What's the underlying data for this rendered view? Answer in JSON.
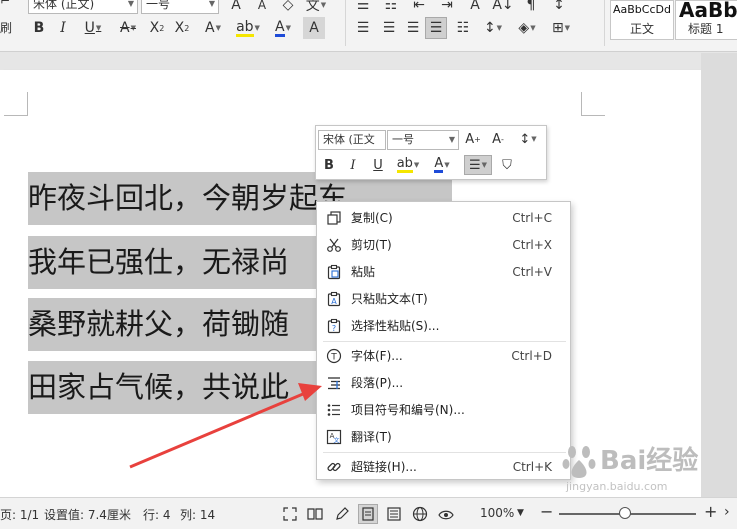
{
  "ribbon": {
    "left_edge_char": "刷",
    "font_name": "宋体 (正文)",
    "font_size": "一号",
    "styles": [
      {
        "sample": "AaBbCcDd",
        "name": "正文"
      },
      {
        "sample": "AaBb",
        "name": "标题 1"
      }
    ],
    "accent_font_color": "#1e4bd8",
    "highlight_color": "#f5e600"
  },
  "mini_toolbar": {
    "font_name": "宋体 (正文",
    "font_size": "一号"
  },
  "document": {
    "lines": [
      {
        "visible": "昨夜斗回北，今朝岁起东"
      },
      {
        "visible": "我年已强仕，无禄尚"
      },
      {
        "visible": "桑野就耕父，荷锄随"
      },
      {
        "visible": "田家占气候，共说此"
      }
    ]
  },
  "context_menu": {
    "items": [
      {
        "label": "复制(C)",
        "shortcut": "Ctrl+C",
        "icon": "copy-icon"
      },
      {
        "label": "剪切(T)",
        "shortcut": "Ctrl+X",
        "icon": "scissors-icon"
      },
      {
        "label": "粘贴",
        "shortcut": "Ctrl+V",
        "icon": "paste-icon"
      },
      {
        "label": "只粘贴文本(T)",
        "shortcut": "",
        "icon": "paste-text-icon"
      },
      {
        "label": "选择性粘贴(S)...",
        "shortcut": "",
        "icon": "paste-special-icon"
      },
      {
        "label": "字体(F)...",
        "shortcut": "Ctrl+D",
        "icon": "font-icon"
      },
      {
        "label": "段落(P)...",
        "shortcut": "",
        "icon": "paragraph-icon"
      },
      {
        "label": "项目符号和编号(N)...",
        "shortcut": "",
        "icon": "bullets-icon"
      },
      {
        "label": "翻译(T)",
        "shortcut": "",
        "icon": "translate-icon"
      },
      {
        "label": "超链接(H)...",
        "shortcut": "Ctrl+K",
        "icon": "hyperlink-icon"
      }
    ]
  },
  "status_bar": {
    "page": "页: 1/1",
    "setting": "设置值: 7.4厘米",
    "row": "行: 4",
    "col": "列: 14",
    "zoom": "100%",
    "zoom_level": 0.48
  },
  "watermark": {
    "site": "jingyan.baidu.com",
    "brand": "Bai经验"
  },
  "colors": {
    "selection": "#c6c6c6",
    "arrow": "#e8413d"
  }
}
